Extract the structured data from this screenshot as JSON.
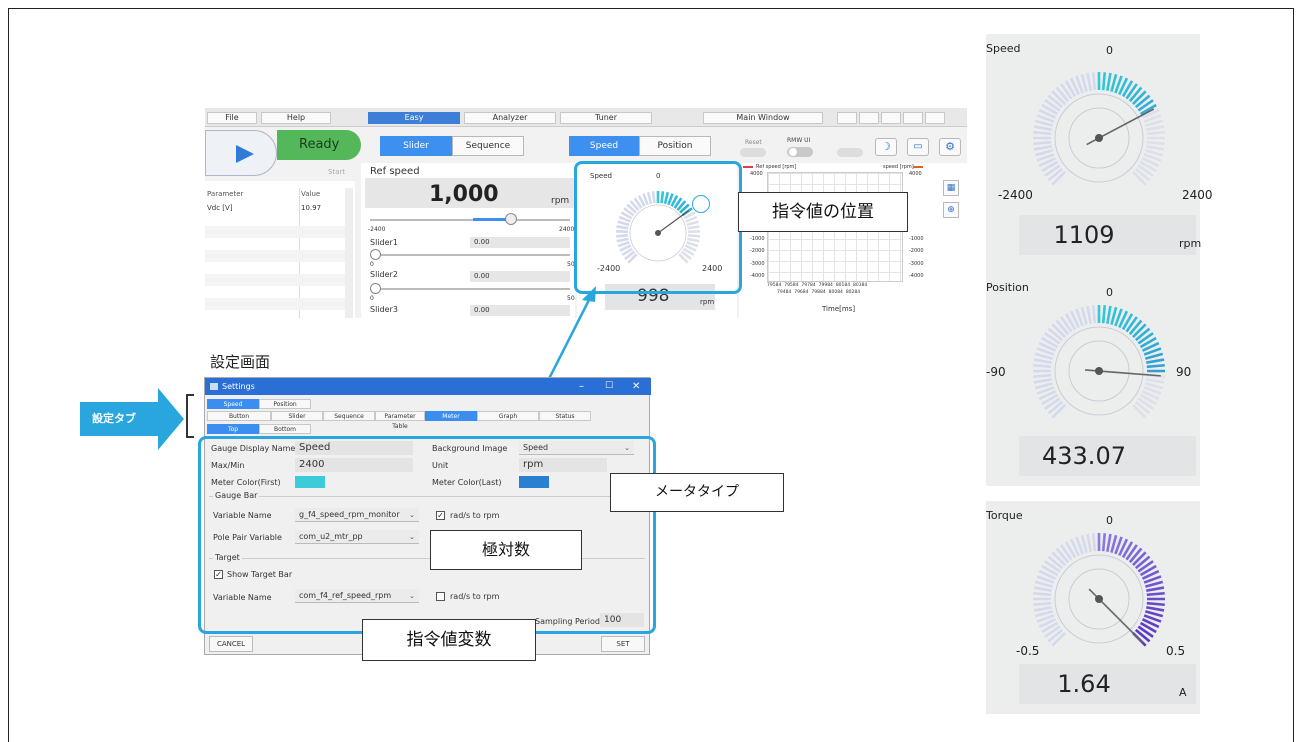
{
  "app": {
    "menu": [
      "File",
      "Help",
      "Easy",
      "Analyzer",
      "Tuner",
      "Main Window"
    ],
    "status": "Ready",
    "start_label": "Start",
    "mode_tabs": [
      "Slider",
      "Sequence"
    ],
    "view_tabs": [
      "Speed",
      "Position"
    ],
    "reset_label": "Reset",
    "rmw_label": "RMW UI",
    "param_headers": [
      "Parameter",
      "Value"
    ],
    "params": [
      {
        "name": "Vdc [V]",
        "value": "10.97"
      }
    ],
    "ref_label": "Ref speed",
    "ref_value": "1,000",
    "ref_unit": "rpm",
    "ref_min": "-2400",
    "ref_max": "2400",
    "sliders": [
      {
        "label": "Slider1",
        "value": "0.00",
        "min": "0",
        "max": "50"
      },
      {
        "label": "Slider2",
        "value": "0.00",
        "min": "0",
        "max": "50"
      },
      {
        "label": "Slider3",
        "value": "0.00"
      }
    ],
    "mini_gauge": {
      "title": "Speed",
      "zero": "0",
      "min": "-2400",
      "max": "2400",
      "value": "998",
      "unit": "rpm",
      "fraction": 0.7
    },
    "plot": {
      "legend_left": "Ref speed [rpm]",
      "legend_right": "speed [rpm]",
      "y_left": [
        "4000",
        "-1000",
        "-2000",
        "-3000",
        "-4000"
      ],
      "y_right": [
        "4000",
        "-1000",
        "-2000",
        "-3000",
        "-4000"
      ],
      "x_row1": [
        "79584",
        "79584",
        "79784",
        "79984",
        "80184",
        "80384"
      ],
      "x_row2": [
        "79484",
        "79684",
        "79884",
        "80084",
        "80284"
      ],
      "xlabel": "Time[ms]"
    }
  },
  "callouts": {
    "target_pos": "指令値の位置",
    "meter_type": "メータタイプ",
    "pole_pairs": "極対数",
    "target_var": "指令値変数",
    "settings_tab": "設定タブ"
  },
  "settings_caption": "設定画面",
  "settings": {
    "title": "Settings",
    "top_tabs": [
      "Speed",
      "Position"
    ],
    "tabs": [
      "Button",
      "Slider",
      "Sequence",
      "Parameter Table",
      "Meter",
      "Graph",
      "Status"
    ],
    "sub_tabs": [
      "Top",
      "Bottom"
    ],
    "gauge_display_name_label": "Gauge Display Name",
    "gauge_display_name": "Speed",
    "background_image_label": "Background Image",
    "background_image": "Speed",
    "maxmin_label": "Max/Min",
    "maxmin": "2400",
    "unit_label": "Unit",
    "unit": "rpm",
    "meter_color_first_label": "Meter Color(First)",
    "meter_color_first": "#3ccbd8",
    "meter_color_last_label": "Meter Color(Last)",
    "meter_color_last": "#2b7fd0",
    "gauge_bar_label": "Gauge Bar",
    "variable_name_label": "Variable Name",
    "gauge_variable": "g_f4_speed_rpm_monitor",
    "rads_label": "rad/s to rpm",
    "rads_checked": true,
    "pole_pair_label": "Pole Pair Variable",
    "pole_pair": "com_u2_mtr_pp",
    "target_label": "Target",
    "show_target_label": "Show Target Bar",
    "show_target_checked": true,
    "target_variable_label": "Variable Name",
    "target_variable": "com_f4_ref_speed_rpm",
    "target_rads_label": "rad/s to rpm",
    "target_rads_checked": false,
    "sampling_label": "Sampling Period",
    "sampling": "100",
    "cancel_label": "CANCEL",
    "set_label": "SET"
  },
  "gauges": [
    {
      "title": "Speed",
      "zero": "0",
      "min": "-2400",
      "max": "2400",
      "value": "1109",
      "unit": "rpm",
      "fraction": 0.73,
      "colorA": "#35c8d6",
      "colorB": "#2e88d2"
    },
    {
      "title": "Position",
      "zero": "0",
      "min": "-90",
      "max": "90",
      "value": "433.07",
      "unit": "",
      "fraction": 0.85,
      "colorA": "#35c8d6",
      "colorB": "#2e88d2"
    },
    {
      "title": "Torque",
      "zero": "0",
      "min": "-0.5",
      "max": "0.5",
      "value": "1.64",
      "unit": "A",
      "fraction": 1.0,
      "colorA": "#8a7be0",
      "colorB": "#5a36c0"
    }
  ]
}
